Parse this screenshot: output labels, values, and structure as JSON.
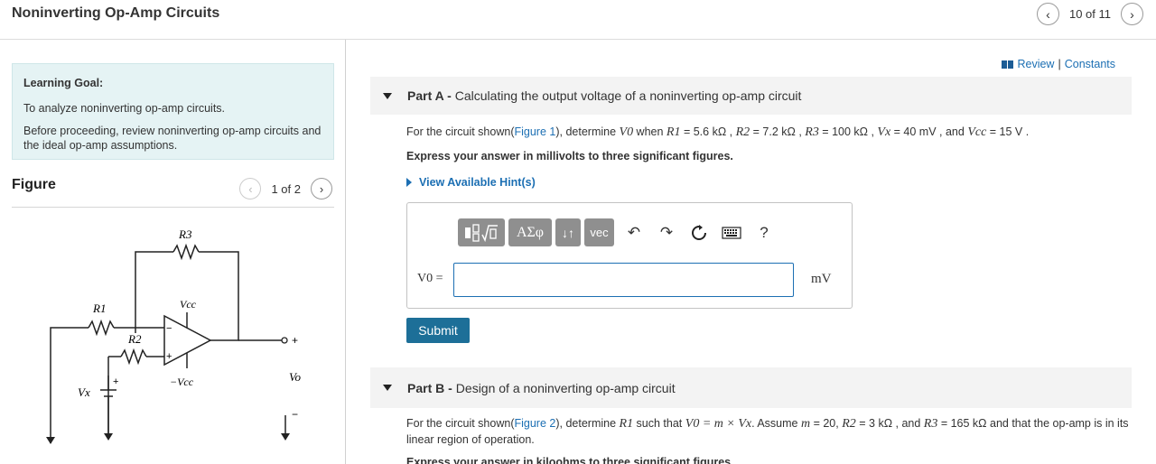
{
  "header": {
    "title": "Noninverting Op-Amp Circuits",
    "pager_text": "10 of 11",
    "prev_icon": "chevron-left-icon",
    "next_icon": "chevron-right-icon"
  },
  "learning_goal": {
    "heading": "Learning Goal:",
    "line1": "To analyze noninverting op-amp circuits.",
    "line2": "Before proceeding, review noninverting op-amp circuits and the ideal op-amp assumptions."
  },
  "figure": {
    "title": "Figure",
    "pager_text": "1 of 2",
    "labels": {
      "r3": "R3",
      "r1": "R1",
      "r2": "R2",
      "vcc": "Vcc",
      "neg_vcc": "−Vcc",
      "vx": "Vx",
      "vo": "Vo",
      "plus": "+",
      "minus": "−",
      "batt_plus": "+"
    }
  },
  "links": {
    "review": "Review",
    "separator": "|",
    "constants": "Constants"
  },
  "part_a": {
    "label": "Part A -",
    "title": "Calculating the output voltage of a noninverting op-amp circuit",
    "q_prefix": "For the circuit shown(",
    "q_link": "Figure 1",
    "q_mid": "), determine ",
    "q_v0": "V0",
    "q_when": " when ",
    "q_r1": "R1",
    "q_r1_val": " = 5.6 kΩ , ",
    "q_r2": "R2",
    "q_r2_val": " = 7.2 kΩ , ",
    "q_r3": "R3",
    "q_r3_val": " = 100 kΩ , ",
    "q_vx": "Vx",
    "q_vx_val": " = 40 mV , and ",
    "q_vcc": "Vcc",
    "q_vcc_val": " = 15 V .",
    "instruction": "Express your answer in millivolts to three significant figures.",
    "hint": "View Available Hint(s)",
    "toolbar": {
      "templates_icon": "template-icon",
      "greek": "ΑΣφ",
      "arrows": "↓↑",
      "vec": "vec",
      "undo_icon": "undo-icon",
      "redo_icon": "redo-icon",
      "reset_icon": "reset-icon",
      "keyboard_icon": "keyboard-icon",
      "help": "?"
    },
    "answer_label": "V0 =",
    "answer_value": "",
    "answer_unit": "mV",
    "submit": "Submit"
  },
  "part_b": {
    "label": "Part B -",
    "title": "Design of a noninverting op-amp circuit",
    "q_prefix": "For the circuit shown(",
    "q_link": "Figure 2",
    "q_mid": "), determine ",
    "q_r1": "R1",
    "q_such": " such that ",
    "q_formula": "V0 = m × Vx",
    "q_assume": ". Assume ",
    "q_m": "m",
    "q_m_val": " = 20, ",
    "q_r2": "R2",
    "q_r2_val": " = 3 kΩ , and ",
    "q_r3": "R3",
    "q_r3_val": " = 165 kΩ and that the op-amp is in its linear region of operation.",
    "instruction": "Express your answer in kiloohms to three significant figures."
  }
}
